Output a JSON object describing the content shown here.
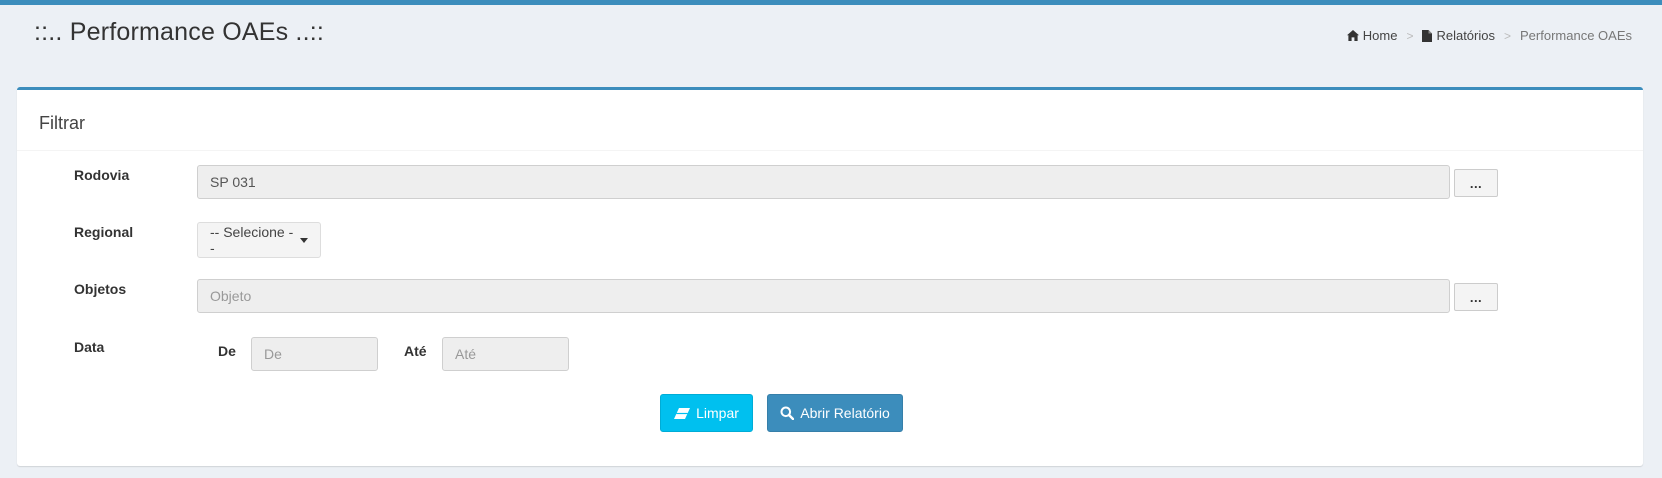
{
  "header": {
    "title": "::.. Performance OAEs ..::",
    "breadcrumb": [
      {
        "label": "Home",
        "icon": "home-icon"
      },
      {
        "label": "Relatórios",
        "icon": "file-icon"
      },
      {
        "label": "Performance OAEs"
      }
    ],
    "separator": ">"
  },
  "filter": {
    "title": "Filtrar",
    "rodovia": {
      "label": "Rodovia",
      "value": "SP 031",
      "button_label": "..."
    },
    "regional": {
      "label": "Regional",
      "selected": "-- Selecione --"
    },
    "objetos": {
      "label": "Objetos",
      "placeholder": "Objeto",
      "button_label": "..."
    },
    "data": {
      "label": "Data",
      "from_label": "De",
      "from_placeholder": "De",
      "to_label": "Até",
      "to_placeholder": "Até"
    },
    "clear_button": {
      "label": "Limpar",
      "icon": "eraser-icon"
    },
    "open_button": {
      "label": "Abrir Relatório",
      "icon": "search-icon"
    }
  },
  "colors": {
    "accent": "#3c8dbc",
    "info": "#00c0ef",
    "background": "#ecf0f5"
  }
}
